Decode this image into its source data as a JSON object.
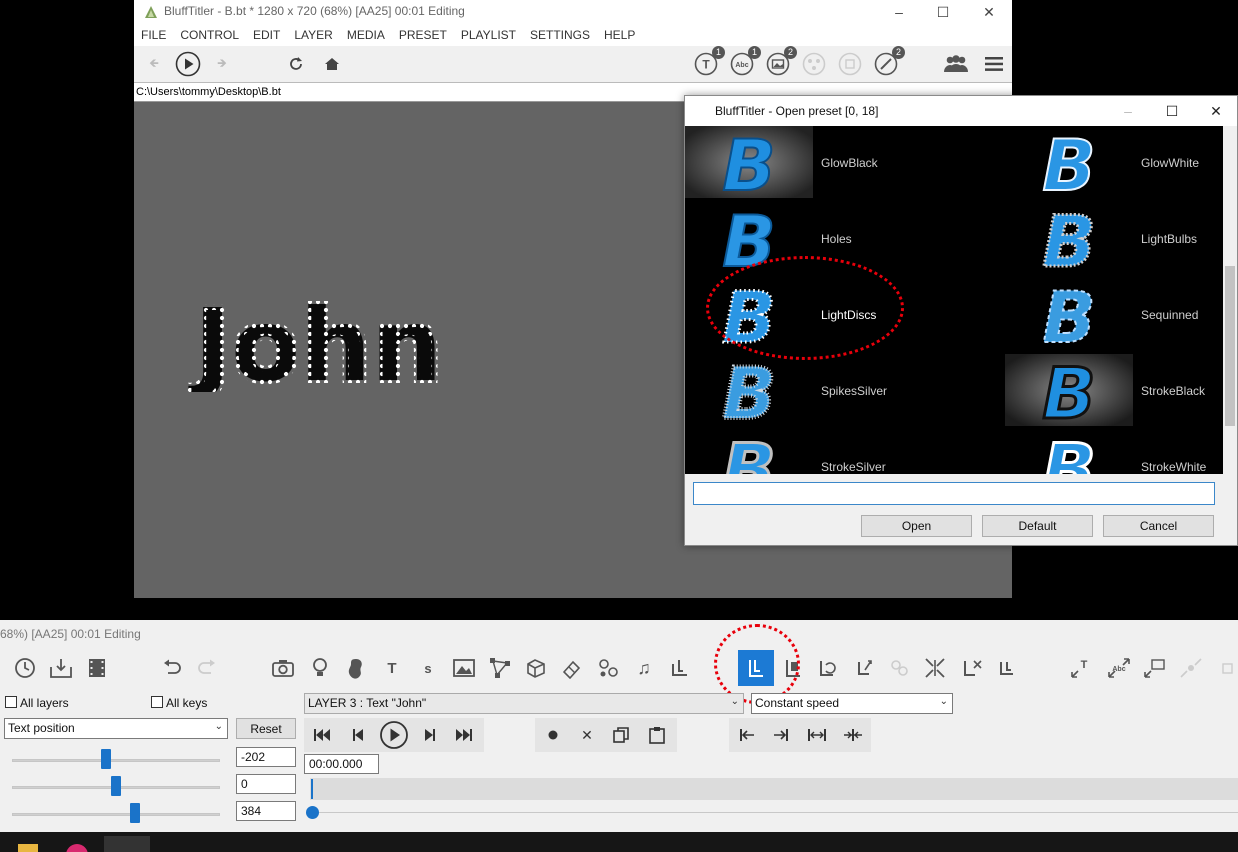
{
  "window": {
    "title": "BluffTitler - B.bt * 1280 x 720 (68%) [AA25] 00:01 Editing",
    "path": "C:\\Users\\tommy\\Desktop\\B.bt"
  },
  "menu": [
    "FILE",
    "CONTROL",
    "EDIT",
    "LAYER",
    "MEDIA",
    "PRESET",
    "PLAYLIST",
    "SETTINGS",
    "HELP"
  ],
  "toolbar_badges": [
    "1",
    "1",
    "2",
    "2"
  ],
  "preview": {
    "text": "John",
    "bg": "#646464"
  },
  "dialog": {
    "title": "BluffTitler - Open preset [0, 18]",
    "presets": [
      "GlowBlack",
      "GlowWhite",
      "Holes",
      "LightBulbs",
      "LightDiscs",
      "Sequinned",
      "SpikesSilver",
      "StrokeBlack",
      "StrokeSilver",
      "StrokeWhite"
    ],
    "selected": "LightDiscs",
    "search_value": "",
    "buttons": {
      "open": "Open",
      "default": "Default",
      "cancel": "Cancel"
    }
  },
  "bottom": {
    "title": "68%) [AA25] 00:01 Editing",
    "all_layers": "All layers",
    "all_keys": "All keys",
    "property": "Text position",
    "reset": "Reset",
    "layer": "LAYER 3  : Text \"John\"",
    "speed": "Constant speed",
    "values": [
      "-202",
      "0",
      "384"
    ],
    "time": "00:00.000"
  },
  "colors": {
    "accent": "#1a73c9",
    "annotation": "#e8000b"
  }
}
